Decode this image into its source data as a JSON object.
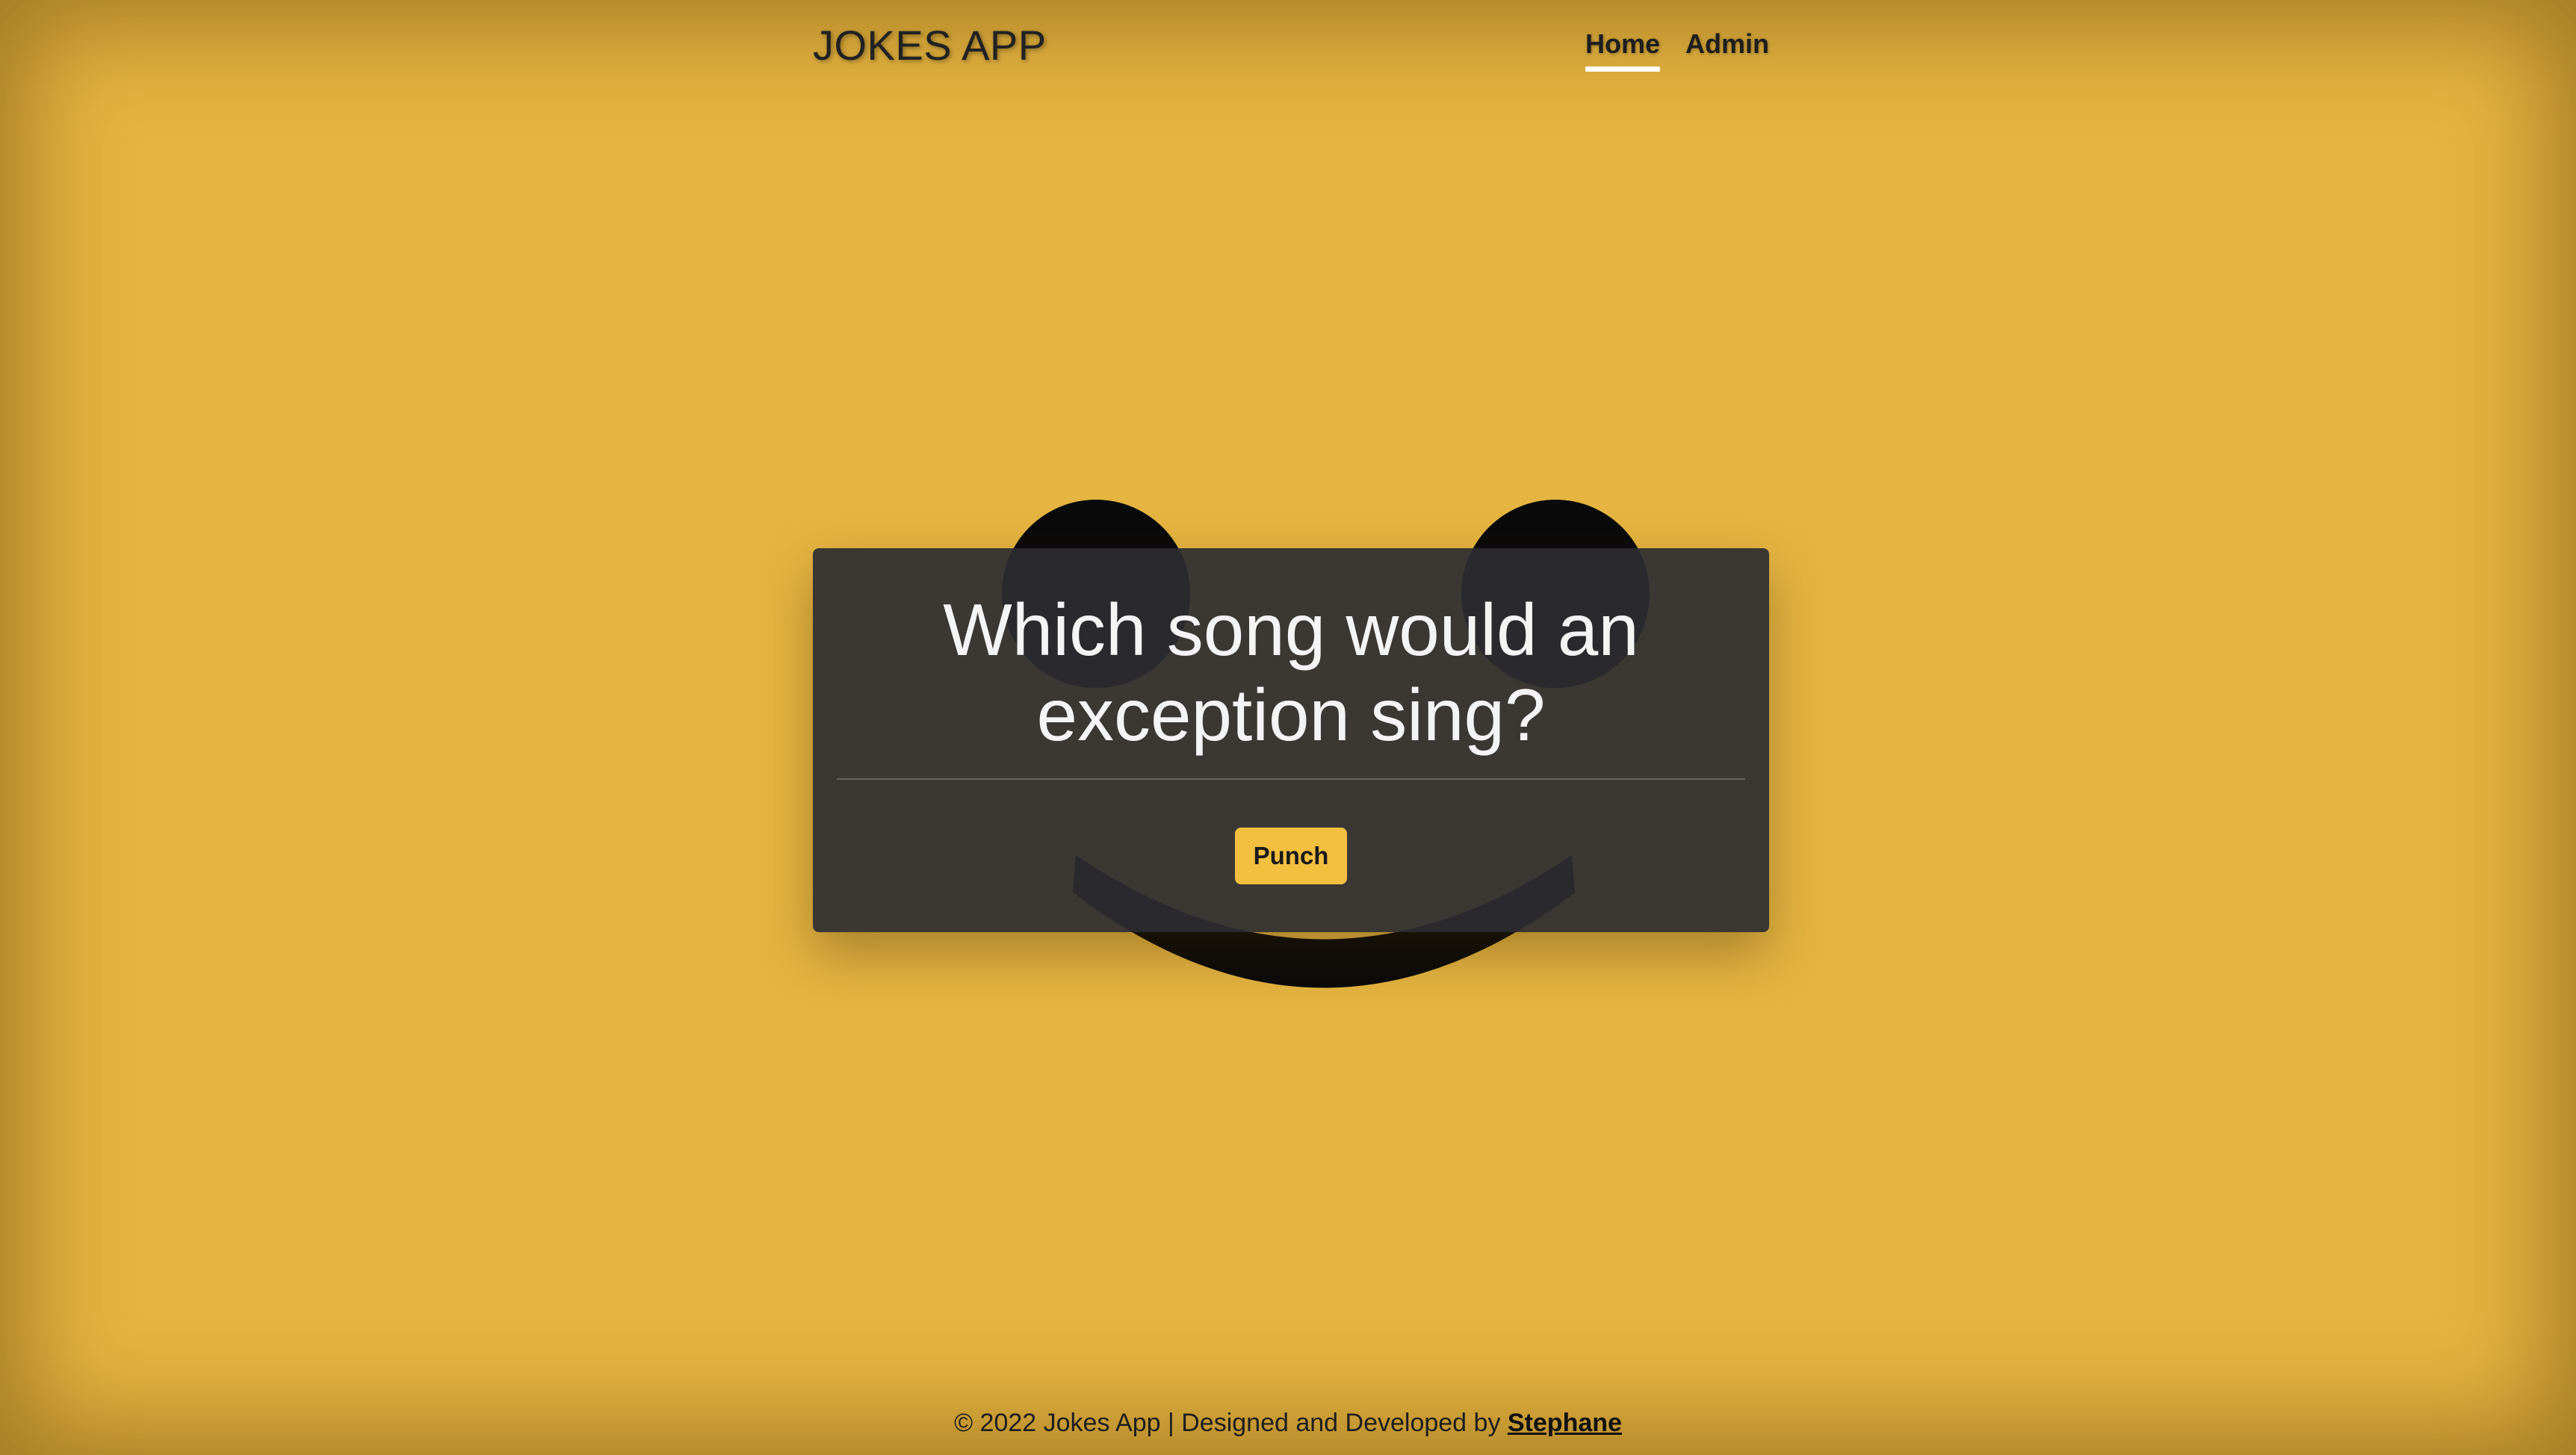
{
  "header": {
    "brand": "JOKES APP",
    "nav": [
      {
        "label": "Home",
        "active": true
      },
      {
        "label": "Admin",
        "active": false
      }
    ]
  },
  "card": {
    "joke_line1": "Which song would an",
    "joke_line2": "exception sing?",
    "punch_label": "Punch"
  },
  "footer": {
    "text": "© 2022 Jokes App | Designed and Developed by ",
    "author": "Stephane"
  },
  "colors": {
    "background": "#e5b441",
    "card": "#2d2d32",
    "button": "#f2bf3f",
    "smiley": "#0a0a0a"
  }
}
